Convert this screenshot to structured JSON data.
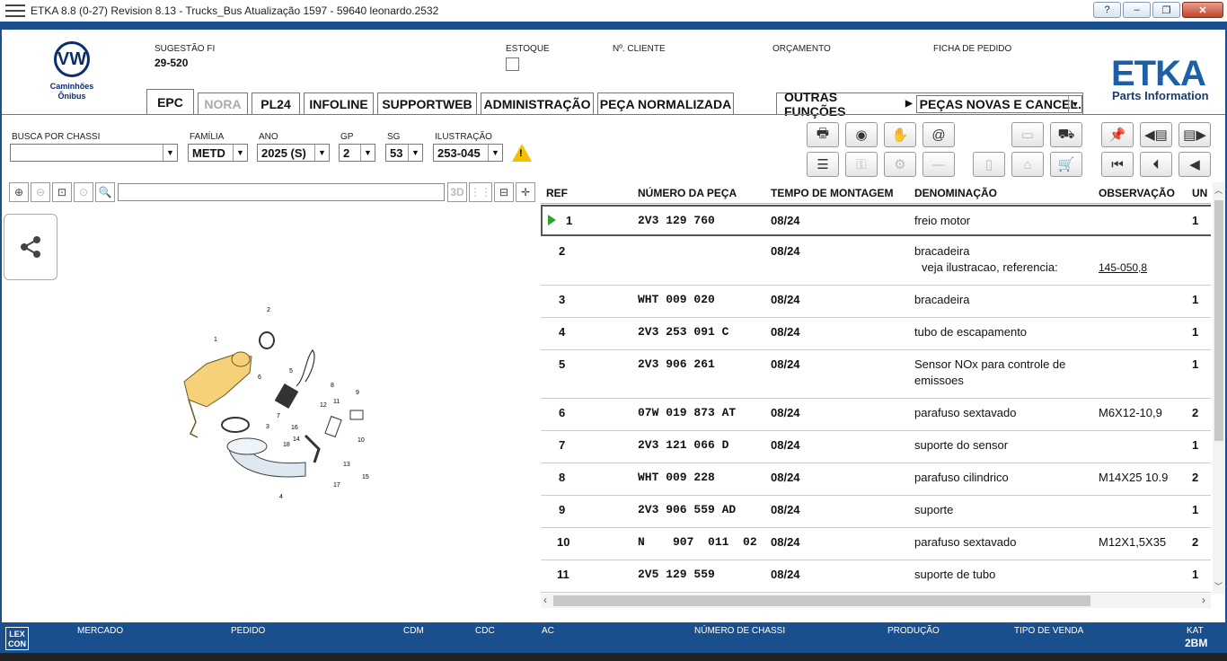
{
  "window": {
    "title": "ETKA 8.8 (0-27) Revision 8.13 - Trucks_Bus Atualização 1597 - 59640 leonardo.2532",
    "buttons": [
      "?",
      "–",
      "❐",
      "✕"
    ]
  },
  "brand": {
    "vw_sub1": "Caminhões",
    "vw_sub2": "Ônibus",
    "etka": "ETKA",
    "etka_sub": "Parts Information"
  },
  "header": {
    "sugestao_label": "SUGESTÃO FI",
    "sugestao_value": "29-520",
    "estoque_label": "ESTOQUE",
    "cliente_label": "Nº. CLIENTE",
    "orcamento_label": "ORÇAMENTO",
    "ficha_label": "FICHA DE PEDIDO"
  },
  "tabs": [
    "EPC",
    "NORA",
    "PL24",
    "INFOLINE",
    "SUPPORTWEB",
    "ADMINISTRAÇÃO",
    "PEÇA NORMALIZADA"
  ],
  "outras": {
    "label": "OUTRAS FUNÇÕES",
    "select": "PEÇAS NOVAS E CANCEL."
  },
  "filters": {
    "chassi_label": "BUSCA POR CHASSI",
    "chassi_value": "",
    "familia_label": "FAMÍLIA",
    "familia_value": "METD",
    "ano_label": "ANO",
    "ano_value": "2025 (S)",
    "gp_label": "GP",
    "gp_value": "2",
    "sg_label": "SG",
    "sg_value": "53",
    "ilustracao_label": "ILUSTRAÇÃO",
    "ilustracao_value": "253-045"
  },
  "viewer": {
    "label_3d": "3D"
  },
  "table": {
    "headers": [
      "REF",
      "NÚMERO DA PEÇA",
      "TEMPO DE MONTAGEM",
      "DENOMINAÇÃO",
      "OBSERVAÇÃO",
      "UN"
    ],
    "rows": [
      {
        "ref": "1",
        "part": "2V3  129  760",
        "tempo": "08/24",
        "denom": "freio motor",
        "obs": "",
        "un": "1"
      },
      {
        "ref": "2",
        "part": "",
        "tempo": "08/24",
        "denom": "bracadeira",
        "denom2": "veja ilustracao, referencia:",
        "obs": "",
        "link": "145-050,8",
        "un": ""
      },
      {
        "ref": "3",
        "part": "WHT  009  020",
        "tempo": "08/24",
        "denom": "bracadeira",
        "obs": "",
        "un": "1"
      },
      {
        "ref": "4",
        "part": "2V3  253  091  C",
        "tempo": "08/24",
        "denom": "tubo de escapamento",
        "obs": "",
        "un": "1"
      },
      {
        "ref": "5",
        "part": "2V3  906  261",
        "tempo": "08/24",
        "denom": "Sensor NOx para controle de",
        "denom2": "emissoes",
        "obs": "",
        "un": "1"
      },
      {
        "ref": "6",
        "part": "07W  019  873  AT",
        "tempo": "08/24",
        "denom": "parafuso sextavado",
        "obs": "M6X12-10,9",
        "un": "2"
      },
      {
        "ref": "7",
        "part": "2V3  121  066  D",
        "tempo": "08/24",
        "denom": "suporte do sensor",
        "obs": "",
        "un": "1"
      },
      {
        "ref": "8",
        "part": "WHT  009  228",
        "tempo": "08/24",
        "denom": "parafuso cilindrico",
        "obs": "M14X25 10.9",
        "un": "2"
      },
      {
        "ref": "9",
        "part": "2V3  906  559  AD",
        "tempo": "08/24",
        "denom": "suporte",
        "obs": "",
        "un": "1"
      },
      {
        "ref": "10",
        "part": "N    907  011  02",
        "tempo": "08/24",
        "denom": "parafuso sextavado",
        "obs": "M12X1,5X35",
        "un": "2"
      },
      {
        "ref": "11",
        "part": "2V5  129  559",
        "tempo": "08/24",
        "denom": "suporte de tubo",
        "obs": "",
        "un": "1"
      }
    ]
  },
  "illustration": {
    "callouts": [
      "1",
      "2",
      "3",
      "4",
      "5",
      "6",
      "7",
      "8",
      "9",
      "10",
      "11",
      "12",
      "13",
      "14",
      "15",
      "16",
      "17",
      "18"
    ]
  },
  "footer": {
    "lexcon": "LEX CON",
    "mercado": "MERCADO",
    "pedido": "PEDIDO",
    "cdm": "CDM",
    "cdc": "CDC",
    "ac": "AC",
    "chassi": "NÚMERO DE CHASSI",
    "producao": "PRODUÇÃO",
    "venda": "TIPO DE VENDA",
    "kat_label": "KAT",
    "kat_value": "2BM"
  }
}
